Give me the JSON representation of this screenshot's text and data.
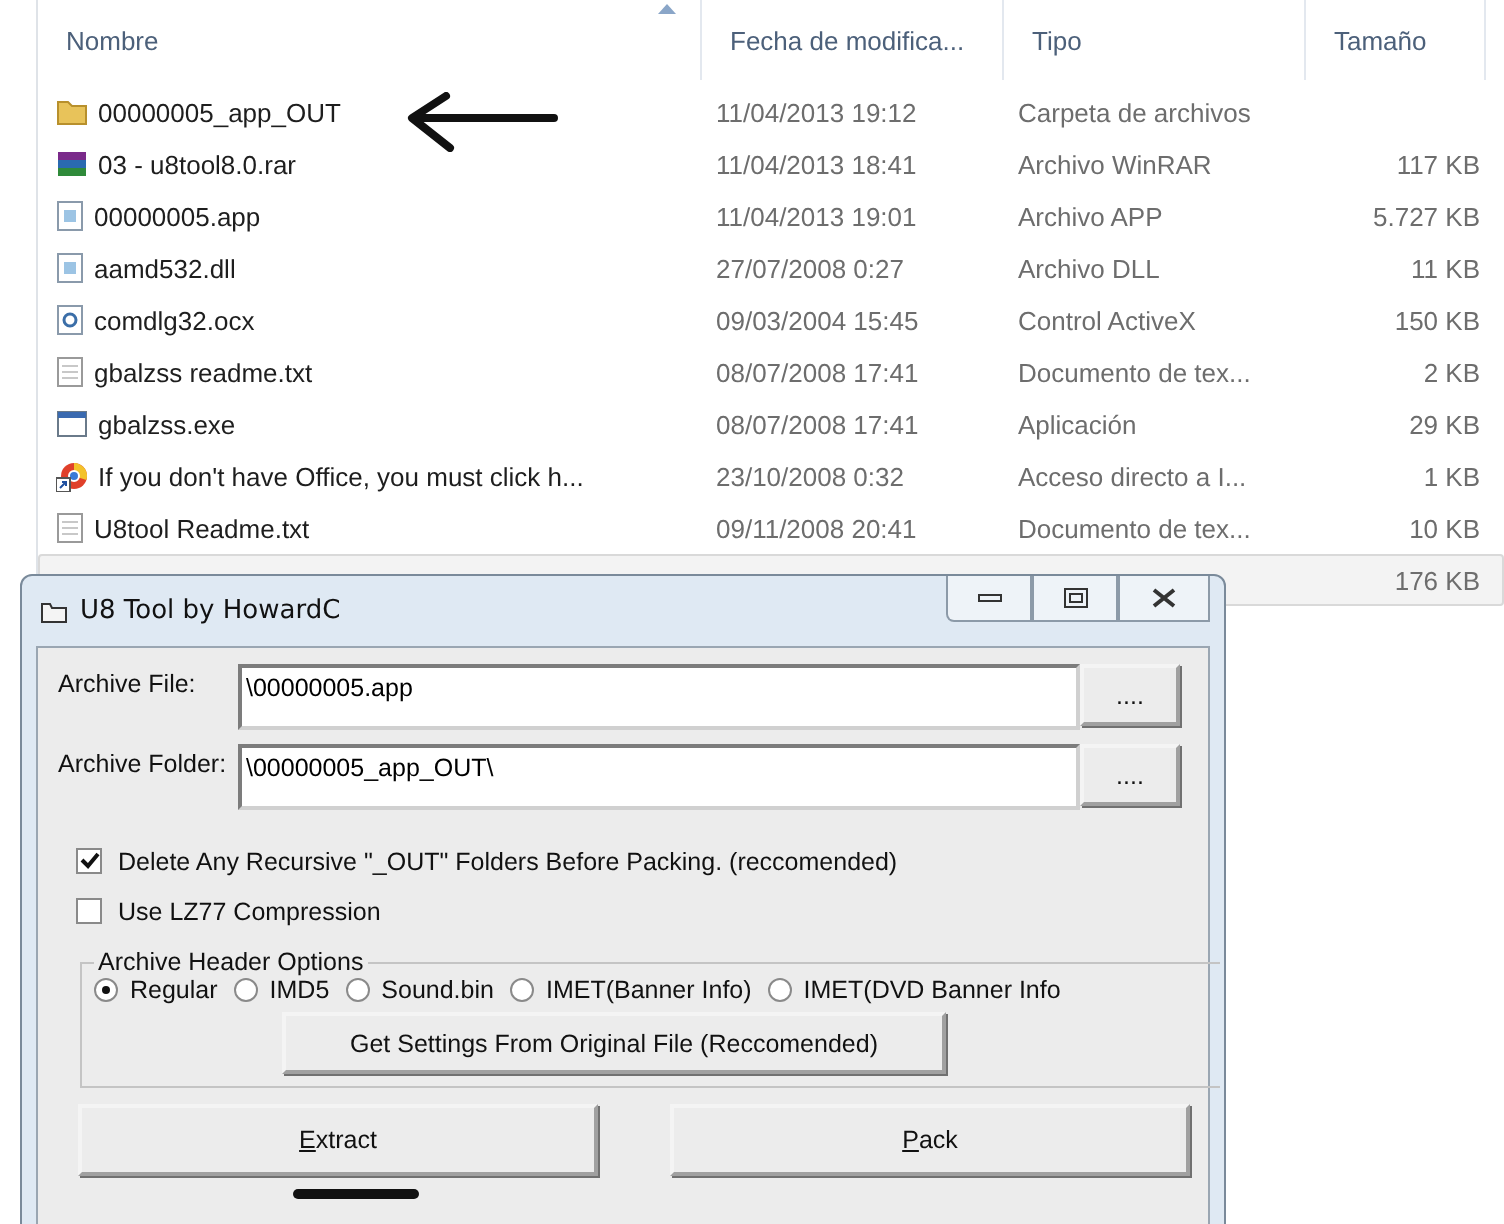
{
  "explorer": {
    "columns": [
      {
        "label": "Nombre",
        "sorted": true
      },
      {
        "label": "Fecha de modifica...",
        "sorted": false
      },
      {
        "label": "Tipo",
        "sorted": false
      },
      {
        "label": "Tamaño",
        "sorted": false
      }
    ],
    "rows": [
      {
        "kind": "folder",
        "name": "00000005_app_OUT",
        "date": "11/04/2013 19:12",
        "type": "Carpeta de archivos",
        "highlighted": false
      },
      {
        "kind": "archive",
        "name": "03 - u8tool8.0.rar",
        "date": "11/04/2013 18:41",
        "type": "Archivo WinRAR",
        "size": "117 KB",
        "highlighted": false
      },
      {
        "kind": "file",
        "name": "00000005.app",
        "date": "11/04/2013 19:01",
        "type": "Archivo APP",
        "size": "5.727 KB",
        "highlighted": false
      },
      {
        "kind": "file",
        "name": "aamd532.dll",
        "date": "27/07/2008 0:27",
        "type": "Archivo DLL",
        "size": "11 KB",
        "highlighted": false
      },
      {
        "kind": "activex",
        "name": "comdlg32.ocx",
        "date": "09/03/2004 15:45",
        "type": "Control ActiveX",
        "size": "150 KB",
        "highlighted": false
      },
      {
        "kind": "text",
        "name": "gbalzss readme.txt",
        "date": "08/07/2008 17:41",
        "type": "Documento de tex...",
        "size": "2 KB",
        "highlighted": false
      },
      {
        "kind": "exe",
        "name": "gbalzss.exe",
        "date": "08/07/2008 17:41",
        "type": "Aplicación",
        "size": "29 KB",
        "highlighted": false
      },
      {
        "kind": "shortcut",
        "name": "If you don't have Office, you must click h...",
        "date": "23/10/2008 0:32",
        "type": "Acceso directo a I...",
        "size": "1 KB",
        "highlighted": false
      },
      {
        "kind": "text",
        "name": "U8tool Readme.txt",
        "date": "09/11/2008 20:41",
        "type": "Documento de tex...",
        "size": "10 KB",
        "highlighted": false
      },
      {
        "size": "176 KB",
        "highlighted": true
      }
    ]
  },
  "dialog": {
    "title": "U8 Tool by HowardC",
    "fields": [
      {
        "label": "Archive File:",
        "value": "\\00000005.app",
        "browse": "...."
      },
      {
        "label": "Archive Folder:",
        "value": "\\00000005_app_OUT\\",
        "browse": "...."
      }
    ],
    "checkboxes": [
      {
        "label": "Delete Any Recursive \"_OUT\" Folders Before Packing.  (reccomended)",
        "checked": true
      },
      {
        "label": "Use LZ77 Compression",
        "checked": false
      }
    ],
    "group": {
      "title": "Archive Header Options",
      "options": [
        {
          "label": "Regular",
          "selected": true
        },
        {
          "label": "IMD5",
          "selected": false
        },
        {
          "label": "Sound.bin",
          "selected": false
        },
        {
          "label": "IMET(Banner Info)",
          "selected": false
        },
        {
          "label": "IMET(DVD Banner Info",
          "selected": false
        }
      ],
      "button": "Get Settings From Original File (Reccomended)"
    },
    "actions": [
      {
        "label": "Extract",
        "mnemonic_first": true
      },
      {
        "label": "Pack",
        "mnemonic_first": true
      }
    ]
  }
}
